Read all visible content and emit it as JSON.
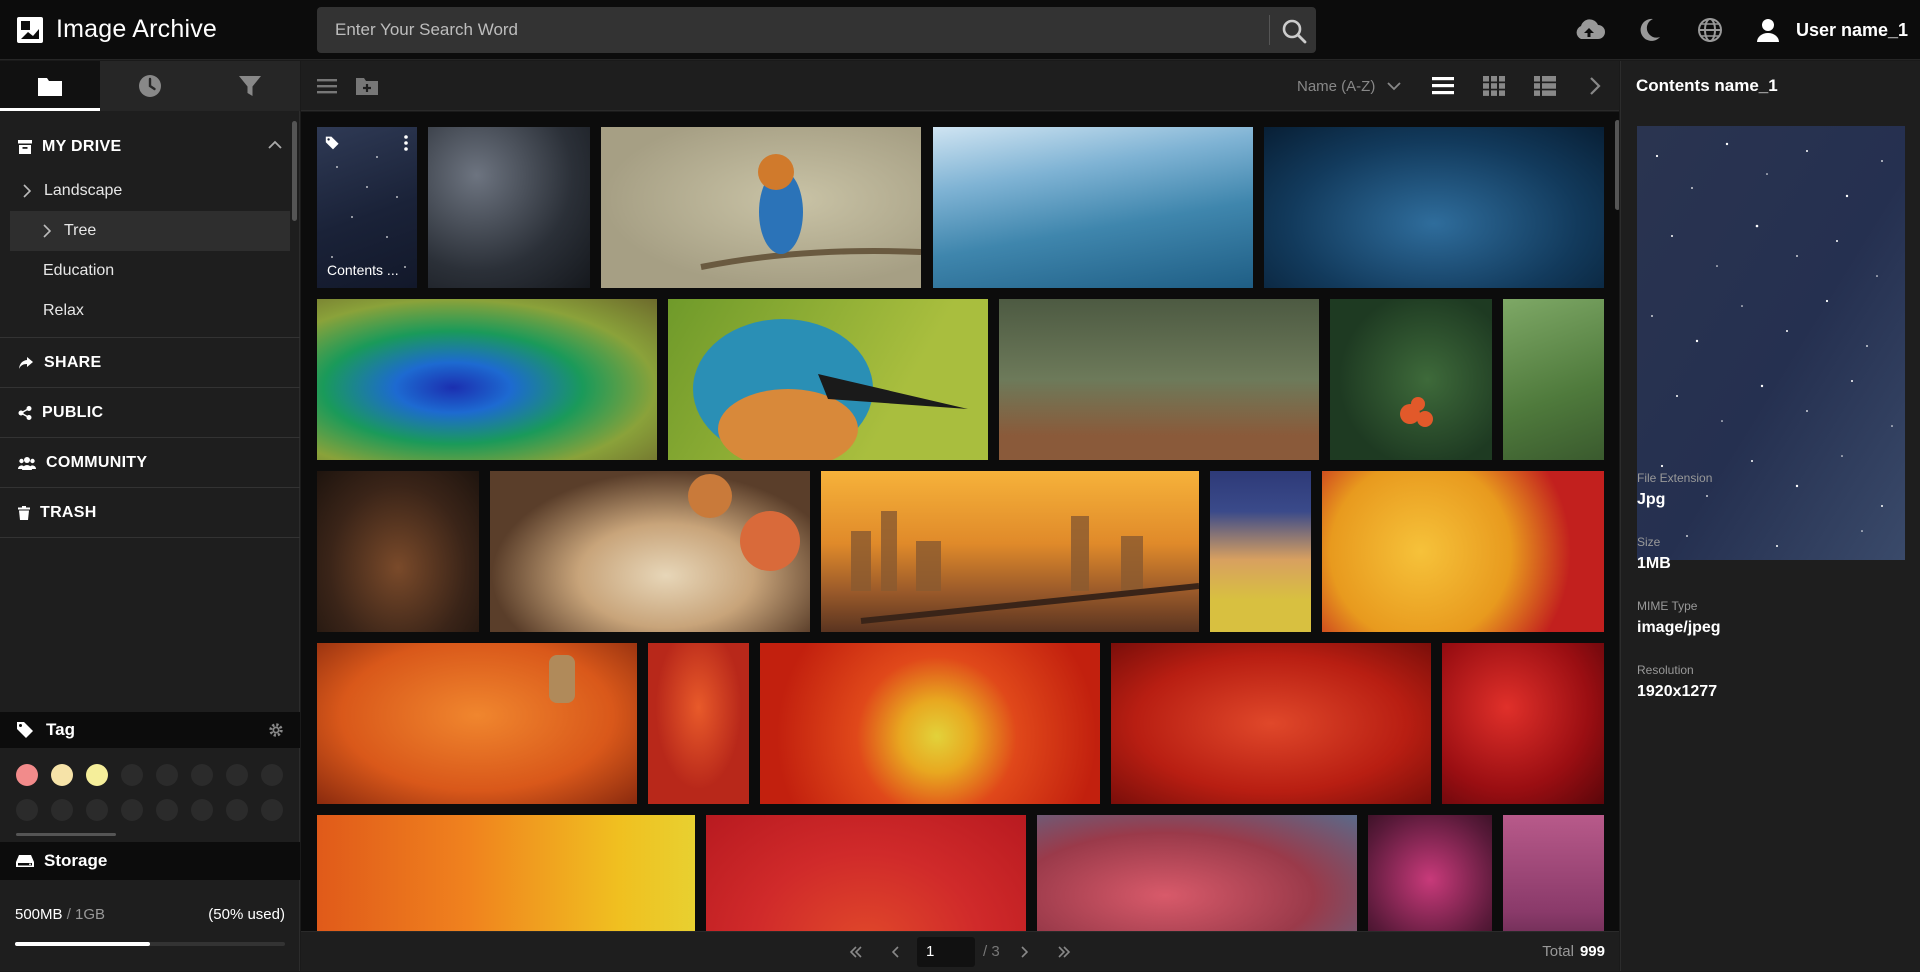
{
  "app": {
    "title": "Image Archive"
  },
  "search": {
    "placeholder": "Enter Your Search Word"
  },
  "user": {
    "name": "User name_1"
  },
  "sidebar": {
    "drive": {
      "label": "MY DRIVE",
      "items": [
        {
          "label": "Landscape"
        },
        {
          "label": "Tree"
        },
        {
          "label": "Education"
        },
        {
          "label": "Relax"
        }
      ]
    },
    "sections": [
      {
        "label": "SHARE",
        "icon": "share-icon"
      },
      {
        "label": "PUBLIC",
        "icon": "public-icon"
      },
      {
        "label": "COMMUNITY",
        "icon": "community-icon"
      },
      {
        "label": "TRASH",
        "icon": "trash-icon"
      }
    ],
    "tag": {
      "title": "Tag",
      "colors": [
        "#f28b8b",
        "#f6e3a8",
        "#f5ee9a"
      ]
    },
    "storage": {
      "title": "Storage",
      "used": "500MB",
      "total": "1GB",
      "percent_text": "(50% used)",
      "fraction": 0.5
    }
  },
  "toolbar": {
    "sort": "Name (A-Z)"
  },
  "gallery": {
    "first_tile_name": "Contents ..."
  },
  "pagination": {
    "current": "1",
    "total_pages": "/ 3",
    "total_label": "Total",
    "total_count": "999"
  },
  "detail": {
    "title": "Contents name_1",
    "fields": [
      {
        "label": "File Extension",
        "value": "Jpg"
      },
      {
        "label": "Size",
        "value": "1MB"
      },
      {
        "label": "MIME Type",
        "value": "image/jpeg"
      },
      {
        "label": "Resolution",
        "value": "1920x1277"
      }
    ]
  },
  "colors": {
    "accent": "#ffffff",
    "topbar": "#0c0c0c",
    "panel": "#1e1e1e"
  }
}
